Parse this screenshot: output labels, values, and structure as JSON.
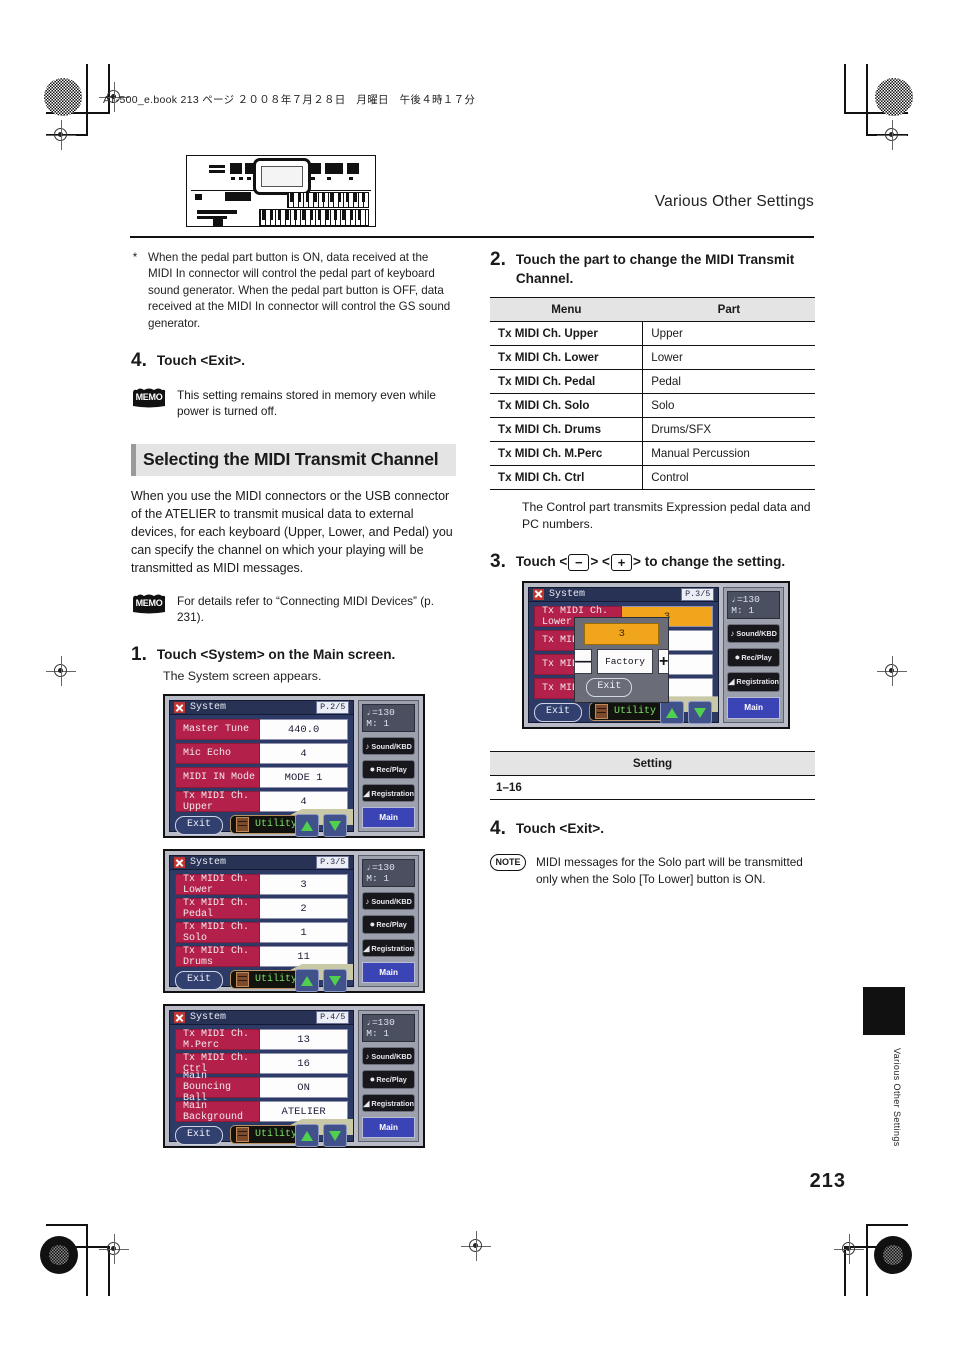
{
  "page": {
    "file_header": "AT-500_e.book  213 ページ  ２００８年７月２８日　月曜日　午後４時１７分",
    "running_head": "Various Other Settings",
    "page_number": "213",
    "thumb_tab_label": "Various Other Settings"
  },
  "left": {
    "footnote": "When the pedal part button is ON, data received at the MIDI In connector will control the pedal part of keyboard sound generator. When the pedal part button is OFF, data received at the MIDI In connector will control the GS sound generator.",
    "footnote_marker": "*",
    "step4": {
      "num": "4.",
      "text": "Touch <Exit>."
    },
    "memo1": {
      "icon": "MEMO",
      "text": "This setting remains stored in memory even while power is turned off."
    },
    "section_title": "Selecting the MIDI Transmit Channel",
    "section_body": "When you use the MIDI connectors or the USB connector of the ATELIER to transmit musical data to external devices, for each keyboard (Upper, Lower, and Pedal) you can specify the channel on which your playing will be transmitted as MIDI messages.",
    "memo2": {
      "icon": "MEMO",
      "text": "For details refer to “Connecting MIDI Devices” (p. 231)."
    },
    "step1": {
      "num": "1.",
      "text": "Touch <System> on the Main screen.",
      "sub": "The System screen appears."
    }
  },
  "right": {
    "step2": {
      "num": "2.",
      "text": "Touch the part to change the MIDI Transmit Channel."
    },
    "part_table": {
      "headers": [
        "Menu",
        "Part"
      ],
      "rows": [
        [
          "Tx MIDI Ch. Upper",
          "Upper"
        ],
        [
          "Tx MIDI Ch. Lower",
          "Lower"
        ],
        [
          "Tx MIDI Ch. Pedal",
          "Pedal"
        ],
        [
          "Tx MIDI Ch. Solo",
          "Solo"
        ],
        [
          "Tx MIDI Ch. Drums",
          "Drums/SFX"
        ],
        [
          "Tx MIDI Ch. M.Perc",
          "Manual Percussion"
        ],
        [
          "Tx MIDI Ch. Ctrl",
          "Control"
        ]
      ]
    },
    "after_table_note": "The Control part transmits Expression pedal data and PC numbers.",
    "step3": {
      "num": "3.",
      "prefix": "Touch <",
      "minus": "−",
      "mid": "> <",
      "plus": "+",
      "suffix": "> to change the setting."
    },
    "setting_table": {
      "header": "Setting",
      "value": "1–16"
    },
    "step4": {
      "num": "4.",
      "text": "Touch <Exit>."
    },
    "note": {
      "icon": "NOTE",
      "text": "MIDI messages for the Solo part will be transmitted only when the Solo [To Lower] button is ON."
    }
  },
  "lcd_common": {
    "title": "System",
    "tempo_line1": "♩=130",
    "tempo_line2": "M:    1",
    "side_buttons": [
      "Sound/KBD",
      "Rec/Play",
      "Registration"
    ],
    "main_button": "Main",
    "exit_button": "Exit",
    "utility_button": "Utility",
    "icons": {
      "close": "close-icon",
      "up": "arrow-up-icon",
      "down": "arrow-down-icon"
    }
  },
  "lcd_screens": [
    {
      "id": "system-page-2",
      "page_badge": "P.2/5",
      "rows": [
        {
          "label": "Master Tune",
          "value": "440.0"
        },
        {
          "label": "Mic Echo",
          "value": "4"
        },
        {
          "label": "MIDI IN Mode",
          "value": "MODE 1"
        },
        {
          "label": "Tx MIDI Ch. Upper",
          "value": "4"
        }
      ]
    },
    {
      "id": "system-page-3",
      "page_badge": "P.3/5",
      "rows": [
        {
          "label": "Tx MIDI Ch. Lower",
          "value": "3"
        },
        {
          "label": "Tx MIDI Ch. Pedal",
          "value": "2"
        },
        {
          "label": "Tx MIDI Ch. Solo",
          "value": "1"
        },
        {
          "label": "Tx MIDI Ch. Drums",
          "value": "11"
        }
      ]
    },
    {
      "id": "system-page-4",
      "page_badge": "P.4/5",
      "rows": [
        {
          "label": "Tx MIDI Ch. M.Perc",
          "value": "13"
        },
        {
          "label": "Tx MIDI Ch. Ctrl",
          "value": "16"
        },
        {
          "label": "Main Bouncing Ball",
          "value": "ON"
        },
        {
          "label": "Main Background",
          "value": "ATELIER"
        }
      ]
    }
  ],
  "lcd_dialog": {
    "id": "system-page-3-edit",
    "page_badge": "P.3/5",
    "rows": [
      {
        "label": "Tx MIDI Ch. Lower",
        "value": "3",
        "highlight": true
      },
      {
        "label": "Tx MIDI",
        "value": ""
      },
      {
        "label": "Tx MIDI",
        "value": ""
      },
      {
        "label": "Tx MIDI",
        "value": ""
      }
    ],
    "popup": {
      "value": "3",
      "minus_label": "—",
      "factory_label": "Factory",
      "plus_label": "+",
      "exit_label": "Exit"
    }
  },
  "colors": {
    "lcd_background": "#2d3a66",
    "lcd_label": "#b3214b",
    "highlight": "#f0a51c",
    "main_button": "#3b44b5",
    "heading_band": "#e4e4e4"
  }
}
